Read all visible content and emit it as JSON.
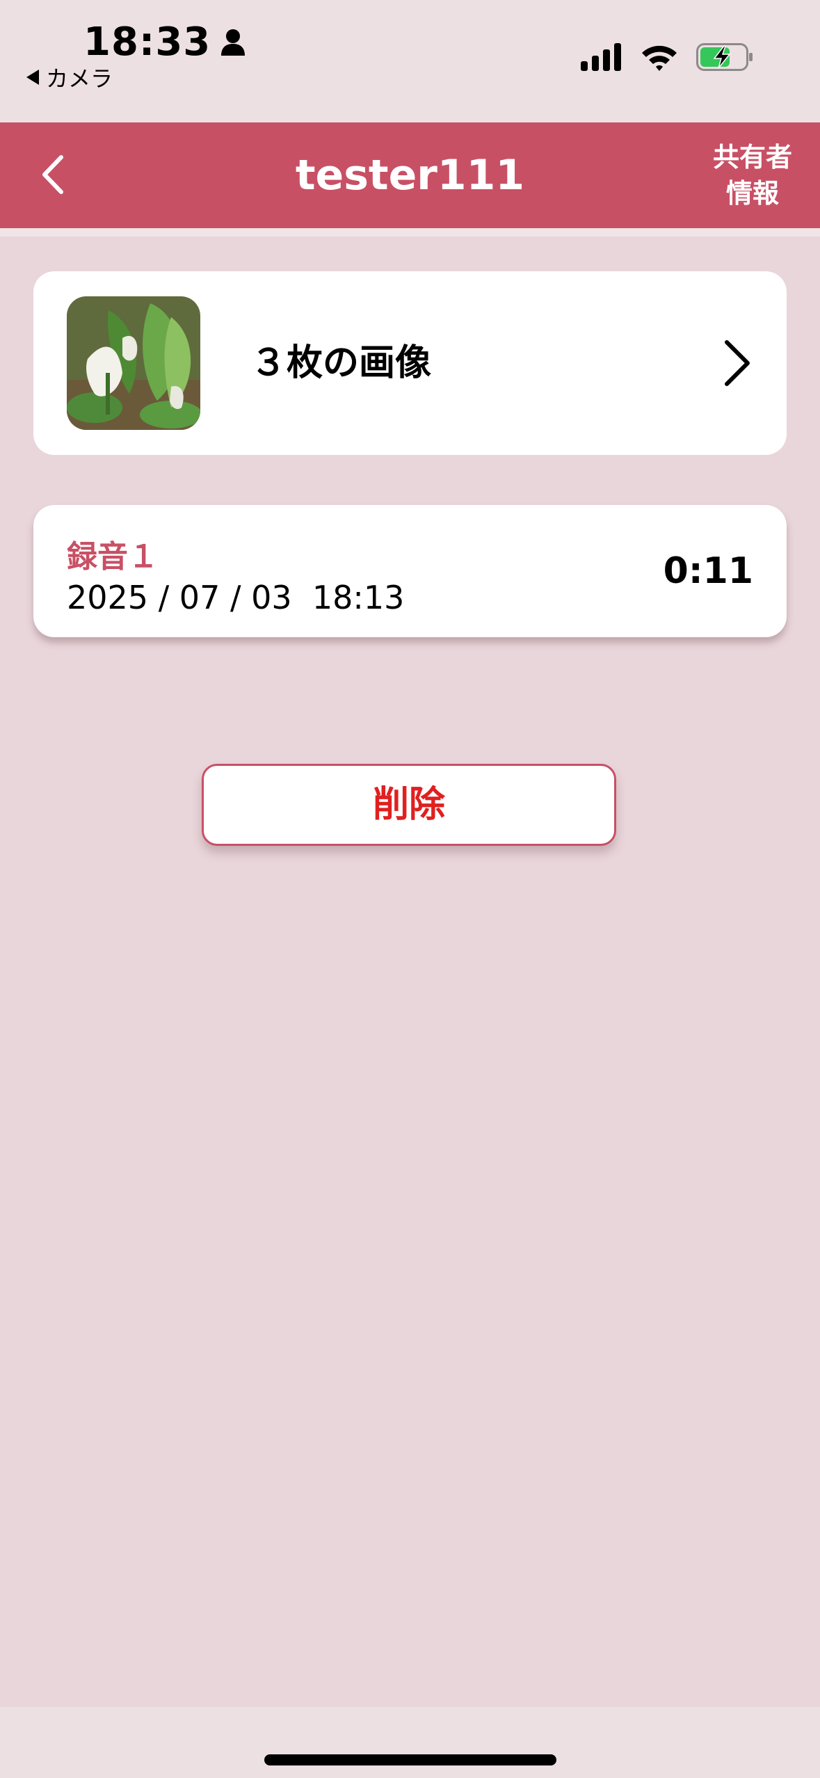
{
  "status_bar": {
    "time": "18:33",
    "back_app_label": "カメラ"
  },
  "header": {
    "title": "tester111",
    "share_button_line1": "共有者",
    "share_button_line2": "情報",
    "color": "#c85065"
  },
  "images_card": {
    "label": "３枚の画像"
  },
  "recording": {
    "title": "録音１",
    "date": "2025 / 07 / 03  18:13",
    "duration": "0:11"
  },
  "delete_button": {
    "label": "削除"
  },
  "icons": {
    "person": "person-icon",
    "signal": "cellular-signal-icon",
    "wifi": "wifi-icon",
    "battery": "battery-charging-icon",
    "back": "chevron-left-icon",
    "forward": "chevron-right-icon"
  }
}
